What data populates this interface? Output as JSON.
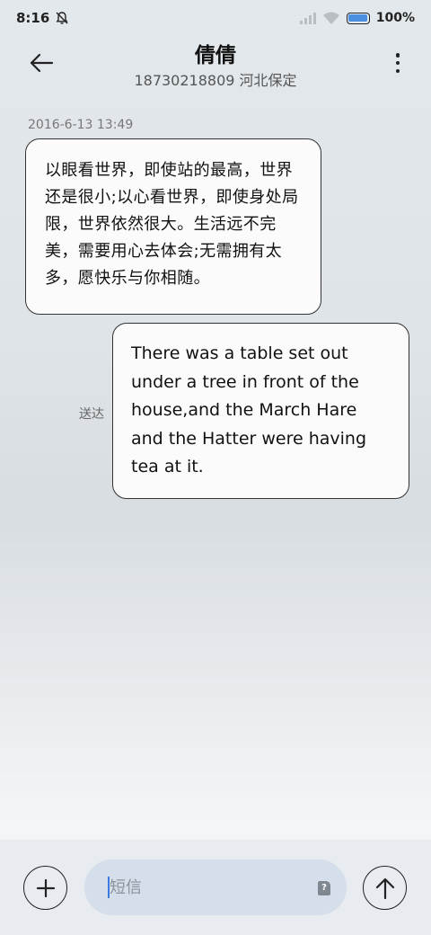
{
  "status_bar": {
    "time": "8:16",
    "battery_level": "100%",
    "icons": [
      "bell-off-icon",
      "signal-icon",
      "wifi-icon",
      "battery-icon"
    ]
  },
  "header": {
    "title": "倩倩",
    "subtitle": "18730218809 河北保定",
    "icons": [
      "back-arrow-icon",
      "more-vertical-icon"
    ]
  },
  "messages": {
    "timestamp": "2016-6-13 13:49",
    "incoming_text": "以眼看世界，即使站的最高，世界还是很小;以心看世界，即使身处局限，世界依然很大。生活远不完美，需要用心去体会;无需拥有太多，愿快乐与你相随。",
    "outgoing_text": "There was a table set out under a tree in front of the house,and the March Hare and the Hatter were having tea at it.",
    "delivered_label": "送达"
  },
  "composer": {
    "placeholder": "短信",
    "value": "",
    "icons": [
      "plus-icon",
      "sim-card-icon",
      "send-arrow-icon"
    ]
  },
  "colors": {
    "accent": "#3a7be0",
    "input_background": "#d5dfeb",
    "bubble_background": "#fbfbfc"
  }
}
